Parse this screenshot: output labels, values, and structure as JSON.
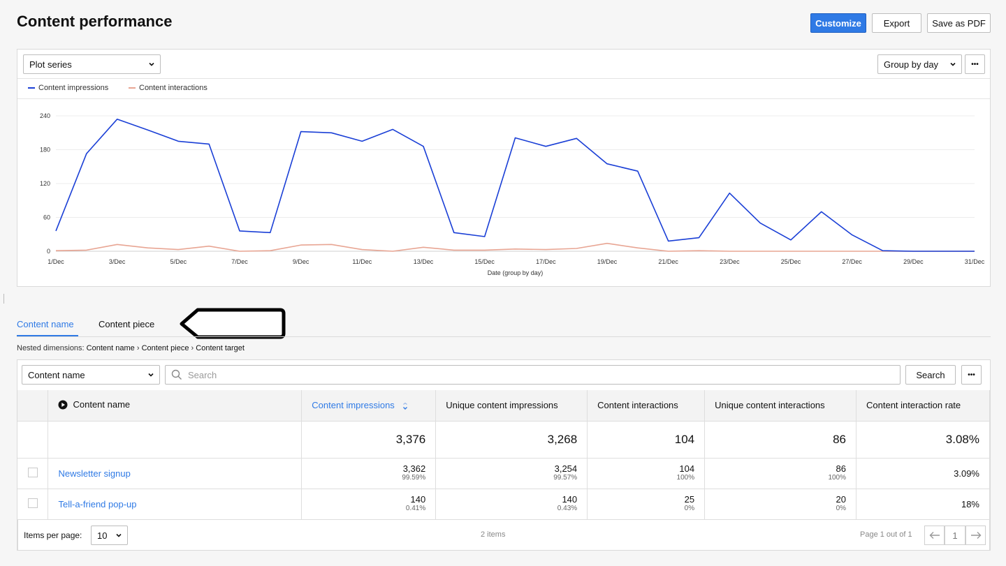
{
  "header": {
    "title": "Content performance",
    "customize_label": "Customize",
    "export_label": "Export",
    "save_pdf_label": "Save as PDF"
  },
  "chart_panel": {
    "plot_series_label": "Plot series",
    "group_by_label": "Group by day",
    "more_label": "•••"
  },
  "chart_data": {
    "type": "line",
    "xlabel": "Date (group by day)",
    "ylabel": "",
    "ylim": [
      0,
      240
    ],
    "yticks": [
      0,
      60,
      120,
      180,
      240
    ],
    "x": [
      "1/Dec",
      "2/Dec",
      "3/Dec",
      "4/Dec",
      "5/Dec",
      "6/Dec",
      "7/Dec",
      "8/Dec",
      "9/Dec",
      "10/Dec",
      "11/Dec",
      "12/Dec",
      "13/Dec",
      "14/Dec",
      "15/Dec",
      "16/Dec",
      "17/Dec",
      "18/Dec",
      "19/Dec",
      "20/Dec",
      "21/Dec",
      "22/Dec",
      "23/Dec",
      "24/Dec",
      "25/Dec",
      "26/Dec",
      "27/Dec",
      "28/Dec",
      "29/Dec",
      "30/Dec",
      "31/Dec"
    ],
    "xtick_labels": [
      "1/Dec",
      "3/Dec",
      "5/Dec",
      "7/Dec",
      "9/Dec",
      "11/Dec",
      "13/Dec",
      "15/Dec",
      "17/Dec",
      "19/Dec",
      "21/Dec",
      "23/Dec",
      "25/Dec",
      "27/Dec",
      "29/Dec",
      "31/Dec"
    ],
    "series": [
      {
        "name": "Content impressions",
        "color": "#1a3fd6",
        "values": [
          36,
          173,
          234,
          215,
          195,
          190,
          36,
          33,
          212,
          210,
          195,
          216,
          186,
          33,
          26,
          201,
          186,
          200,
          155,
          142,
          18,
          24,
          103,
          50,
          20,
          70,
          29,
          1,
          0,
          0,
          0
        ]
      },
      {
        "name": "Content interactions",
        "color": "#e8a593",
        "values": [
          1,
          2,
          12,
          6,
          3,
          9,
          0,
          1,
          11,
          12,
          3,
          0,
          7,
          2,
          2,
          4,
          3,
          5,
          14,
          6,
          0,
          1,
          0,
          0,
          0,
          0,
          0,
          0,
          0,
          0,
          0
        ]
      }
    ],
    "legend_position": "top-left",
    "grid": true
  },
  "tabs": [
    {
      "label": "Content name",
      "active": true
    },
    {
      "label": "Content piece",
      "active": false
    }
  ],
  "breadcrumb": {
    "prefix": "Nested dimensions:",
    "items": [
      "Content name",
      "Content piece",
      "Content target"
    ],
    "separator": "›"
  },
  "table_toolbar": {
    "dimension_select": "Content name",
    "search_placeholder": "Search",
    "search_button": "Search",
    "more_label": "•••"
  },
  "table": {
    "columns": [
      "Content name",
      "Content impressions",
      "Unique content impressions",
      "Content interactions",
      "Unique content interactions",
      "Content interaction rate"
    ],
    "totals": [
      "",
      "3,376",
      "3,268",
      "104",
      "86",
      "3.08%"
    ],
    "rows": [
      {
        "name": "Newsletter signup",
        "impressions": "3,362",
        "impressions_pct": "99.59%",
        "unique_impressions": "3,254",
        "unique_impressions_pct": "99.57%",
        "interactions": "104",
        "interactions_pct": "100%",
        "unique_interactions": "86",
        "unique_interactions_pct": "100%",
        "rate": "3.09%"
      },
      {
        "name": "Tell-a-friend pop-up",
        "impressions": "140",
        "impressions_pct": "0.41%",
        "unique_impressions": "140",
        "unique_impressions_pct": "0.43%",
        "interactions": "25",
        "interactions_pct": "0%",
        "unique_interactions": "20",
        "unique_interactions_pct": "0%",
        "rate": "18%"
      }
    ]
  },
  "footer": {
    "items_per_page_label": "Items per page:",
    "items_per_page_value": "10",
    "item_count": "2 items",
    "page_info": "Page 1 out of 1",
    "current_page": "1"
  },
  "colors": {
    "accent": "#2f7ae5",
    "annotation": "#000000"
  }
}
